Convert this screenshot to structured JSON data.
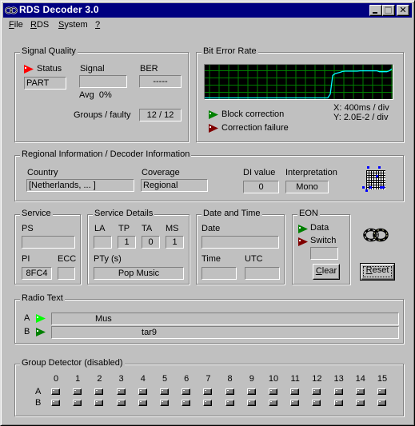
{
  "window": {
    "title": "RDS Decoder 3.0",
    "icon": "infinity-app-icon",
    "controls": {
      "minimize": "_",
      "maximize": "□",
      "close": "×"
    }
  },
  "menu": [
    {
      "label": "File",
      "accel": "F"
    },
    {
      "label": "RDS",
      "accel": "R"
    },
    {
      "label": "System",
      "accel": "S"
    },
    {
      "label": "?",
      "accel": "?"
    }
  ],
  "signal_quality": {
    "title": "Signal Quality",
    "status_label": "Status",
    "status_value": "PART",
    "status_flag_color": "#ff0000",
    "signal_label": "Signal",
    "signal_value": "",
    "ber_label": "BER",
    "ber_value": "-----",
    "avg_label": "Avg",
    "avg_value": "0%",
    "groups_label": "Groups / faulty",
    "groups_value": "12 / 12"
  },
  "bit_error_rate": {
    "title": "Bit Error Rate",
    "legend": [
      {
        "label": "Block correction",
        "color": "#008000"
      },
      {
        "label": "Correction failure",
        "color": "#800000"
      }
    ],
    "x_scale": "X: 400ms / div",
    "y_scale": "Y: 2.0E-2 / div",
    "trace_color": "#00ffff",
    "grid_color": "#008000",
    "trace": [
      0,
      0,
      0,
      0,
      0,
      0,
      0,
      0,
      0,
      0,
      0,
      0,
      0,
      0,
      0,
      0,
      0,
      0,
      0,
      0,
      0,
      0,
      0,
      0,
      0,
      0,
      0,
      0,
      0,
      0,
      0,
      0,
      0,
      0,
      0,
      0,
      0,
      0,
      0,
      0,
      0,
      0,
      0,
      0,
      0,
      0,
      0,
      0,
      0,
      0,
      0.0,
      0.12,
      0.72,
      0.78,
      0.8,
      0.82,
      0.85,
      0.86,
      0.86,
      0.86,
      0.86,
      0.86,
      0.86,
      0.87,
      0.87,
      0.87,
      0.87,
      0.87,
      0.87,
      0.87,
      0.87,
      0.84,
      0.84,
      0.84,
      0.84,
      0.87,
      0.93
    ]
  },
  "regional": {
    "title": "Regional Information / Decoder Information",
    "country_label": "Country",
    "country_value": "[Netherlands, ... ]",
    "coverage_label": "Coverage",
    "coverage_value": "Regional",
    "di_label": "DI value",
    "di_value": "0",
    "interpretation_label": "Interpretation",
    "interpretation_value": "Mono",
    "icon": "di-matrix-icon"
  },
  "service": {
    "title": "Service",
    "ps_label": "PS",
    "ps_value": "",
    "pi_label": "PI",
    "pi_value": "8FC4",
    "ecc_label": "ECC",
    "ecc_value": ""
  },
  "service_details": {
    "title": "Service Details",
    "la_label": "LA",
    "la_value": "",
    "tp_label": "TP",
    "tp_value": "1",
    "ta_label": "TA",
    "ta_value": "0",
    "ms_label": "MS",
    "ms_value": "1",
    "pty_label": "PTy (s)",
    "pty_value": "Pop Music"
  },
  "date_time": {
    "title": "Date and Time",
    "date_label": "Date",
    "date_value": "",
    "time_label": "Time",
    "time_value": "",
    "utc_label": "UTC",
    "utc_value": ""
  },
  "eon": {
    "title": "EON",
    "data_label": "Data",
    "data_flag_color": "#008000",
    "switch_label": "Switch",
    "switch_flag_color": "#800000",
    "switch_value": "",
    "clear_label": "Clear",
    "clear_accel": "C"
  },
  "actions": {
    "link_icon": "infinity-link-icon",
    "reset_label": "Reset",
    "reset_accel": "R"
  },
  "radio_text": {
    "title": "Radio Text",
    "rows": [
      {
        "label": "A",
        "flag_color": "#00ff00",
        "value": "                 Mus"
      },
      {
        "label": "B",
        "flag_color": "#008000",
        "value": "                                    tar9"
      }
    ]
  },
  "group_detector": {
    "title": "Group Detector (disabled)",
    "columns": [
      "0",
      "1",
      "2",
      "3",
      "4",
      "5",
      "6",
      "7",
      "8",
      "9",
      "10",
      "11",
      "12",
      "13",
      "14",
      "15"
    ],
    "rows": [
      "A",
      "B"
    ]
  }
}
